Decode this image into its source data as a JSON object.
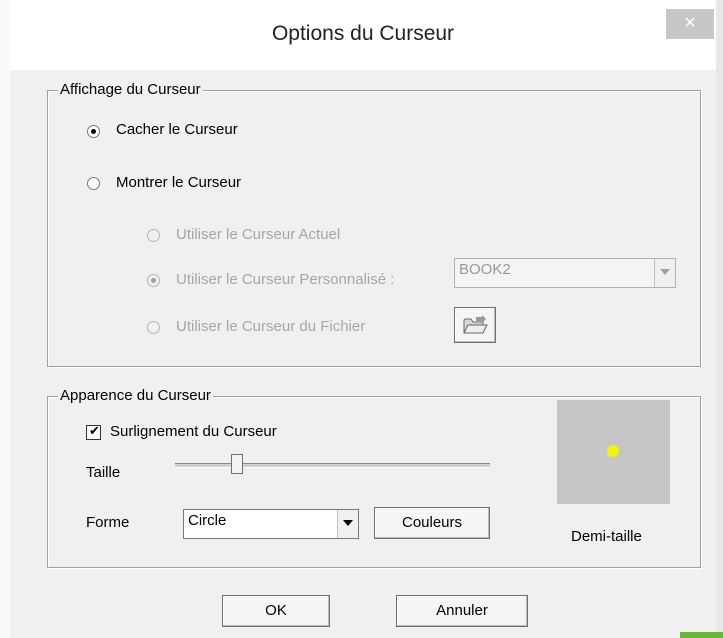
{
  "dialog": {
    "title": "Options du Curseur",
    "close_glyph": "×"
  },
  "display_group": {
    "title": "Affichage du Curseur",
    "hide_cursor_label": "Cacher le Curseur",
    "show_cursor_label": "Montrer le Curseur",
    "use_current_label": "Utiliser le Curseur Actuel",
    "use_custom_label": "Utiliser le Curseur Personnalisé :",
    "custom_cursor_value": "BOOK2",
    "use_file_label": "Utiliser le Curseur du Fichier"
  },
  "appearance_group": {
    "title": "Apparence du Curseur",
    "highlight_label": "Surlignement du Curseur",
    "highlight_checked": true,
    "size_label": "Taille",
    "size_value_fraction": 0.2,
    "shape_label": "Forme",
    "shape_value": "Circle",
    "colors_button": "Couleurs",
    "preview_caption": "Demi-taille",
    "preview_bg": "#c6c6c6",
    "preview_dot_color": "#f5f500"
  },
  "footer": {
    "ok_label": "OK",
    "cancel_label": "Annuler"
  },
  "icons": [
    "close-icon",
    "folder-open-icon",
    "chevron-down-icon"
  ]
}
